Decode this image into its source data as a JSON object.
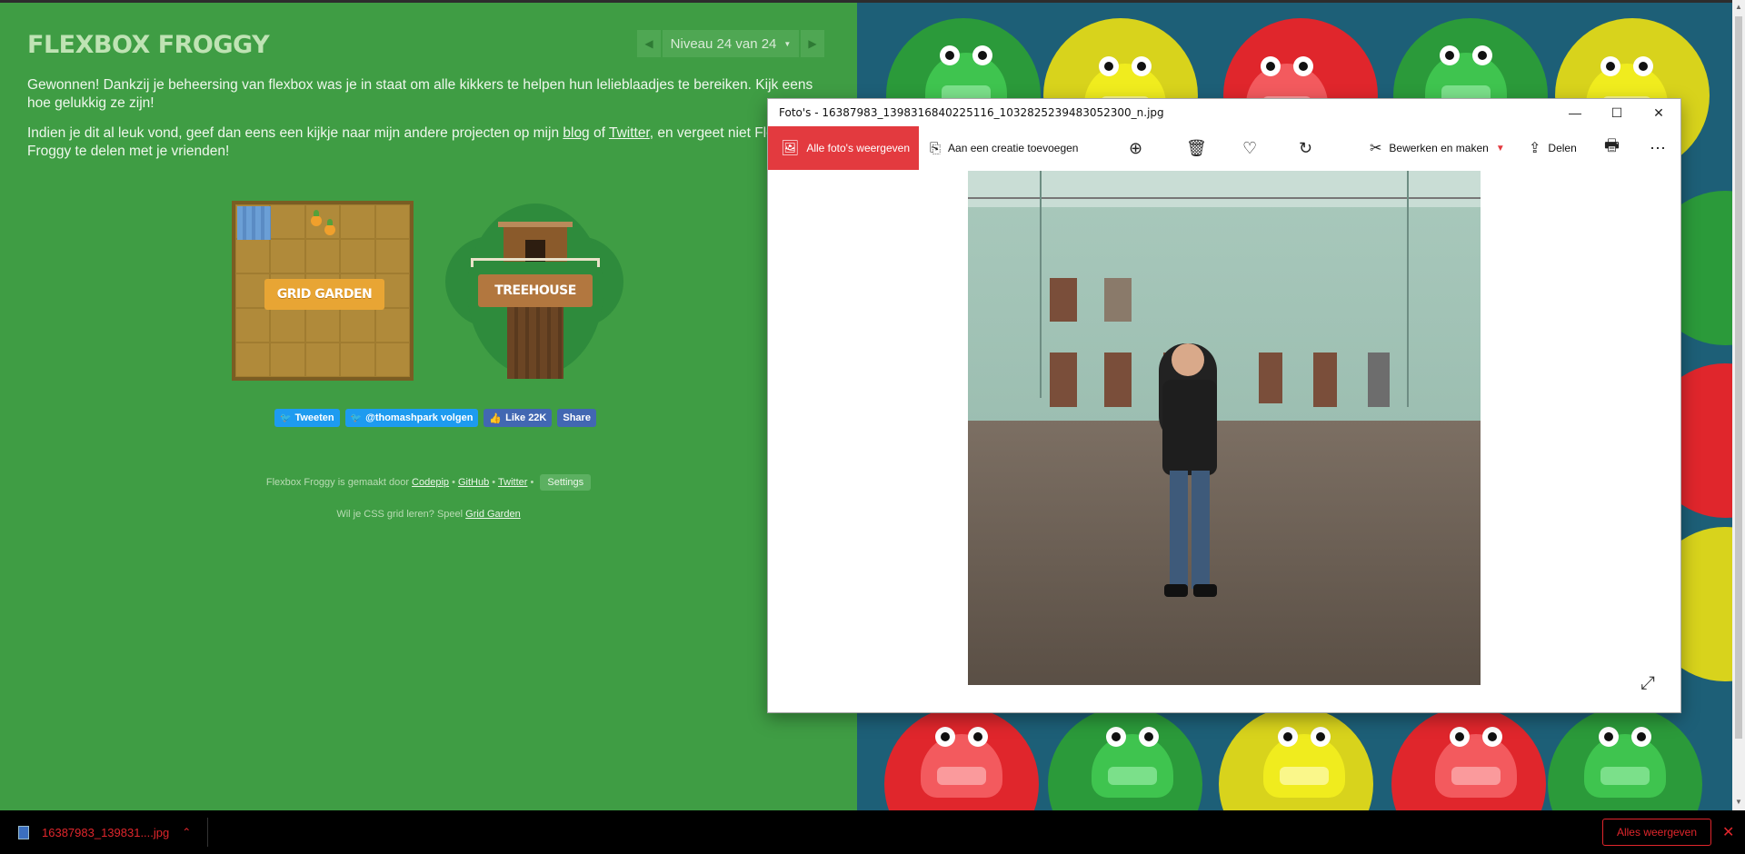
{
  "game": {
    "title": "FLEXBOX FROGGY",
    "level_label": "Niveau 24 van 24",
    "para1": "Gewonnen! Dankzij je beheersing van flexbox was je in staat om alle kikkers te helpen hun lelieblaadjes te bereiken. Kijk eens hoe gelukkig ze zijn!",
    "para2_before": "Indien je dit al leuk vond, geef dan eens een kijkje naar mijn andere projecten op mijn ",
    "para2_blog": "blog",
    "para2_of": " of ",
    "para2_twitter": "Twitter",
    "para2_after": ", en vergeet niet Flexbox Froggy te delen met je vrienden!",
    "grid_garden_label": "GRID GARDEN",
    "treehouse_label": "TREEHOUSE",
    "social": {
      "tweet": "Tweeten",
      "follow": "@thomashpark volgen",
      "like": "Like 22K",
      "share": "Share"
    },
    "footer1": {
      "prefix": "Flexbox Froggy is gemaakt door ",
      "codepip": "Codepip",
      "sep": " • ",
      "github": "GitHub",
      "twitter": "Twitter",
      "settings": "Settings"
    },
    "footer2": {
      "prefix": "Wil je CSS grid leren? Speel ",
      "link": "Grid Garden"
    }
  },
  "photos_window": {
    "title": "Foto's - 16387983_1398316840225116_1032825239483052300_n.jpg",
    "toolbar": {
      "all_photos": "Alle foto's weergeven",
      "add_creation": "Aan een creatie toevoegen",
      "edit_create": "Bewerken en maken",
      "share": "Delen"
    }
  },
  "download_bar": {
    "filename": "16387983_139831....jpg",
    "show_all": "Alles weergeven"
  },
  "colors": {
    "game_green": "#3f9d44",
    "frog_water": "#1d5f77",
    "photos_accent": "#e33a3f",
    "download_red": "#e0262c"
  }
}
